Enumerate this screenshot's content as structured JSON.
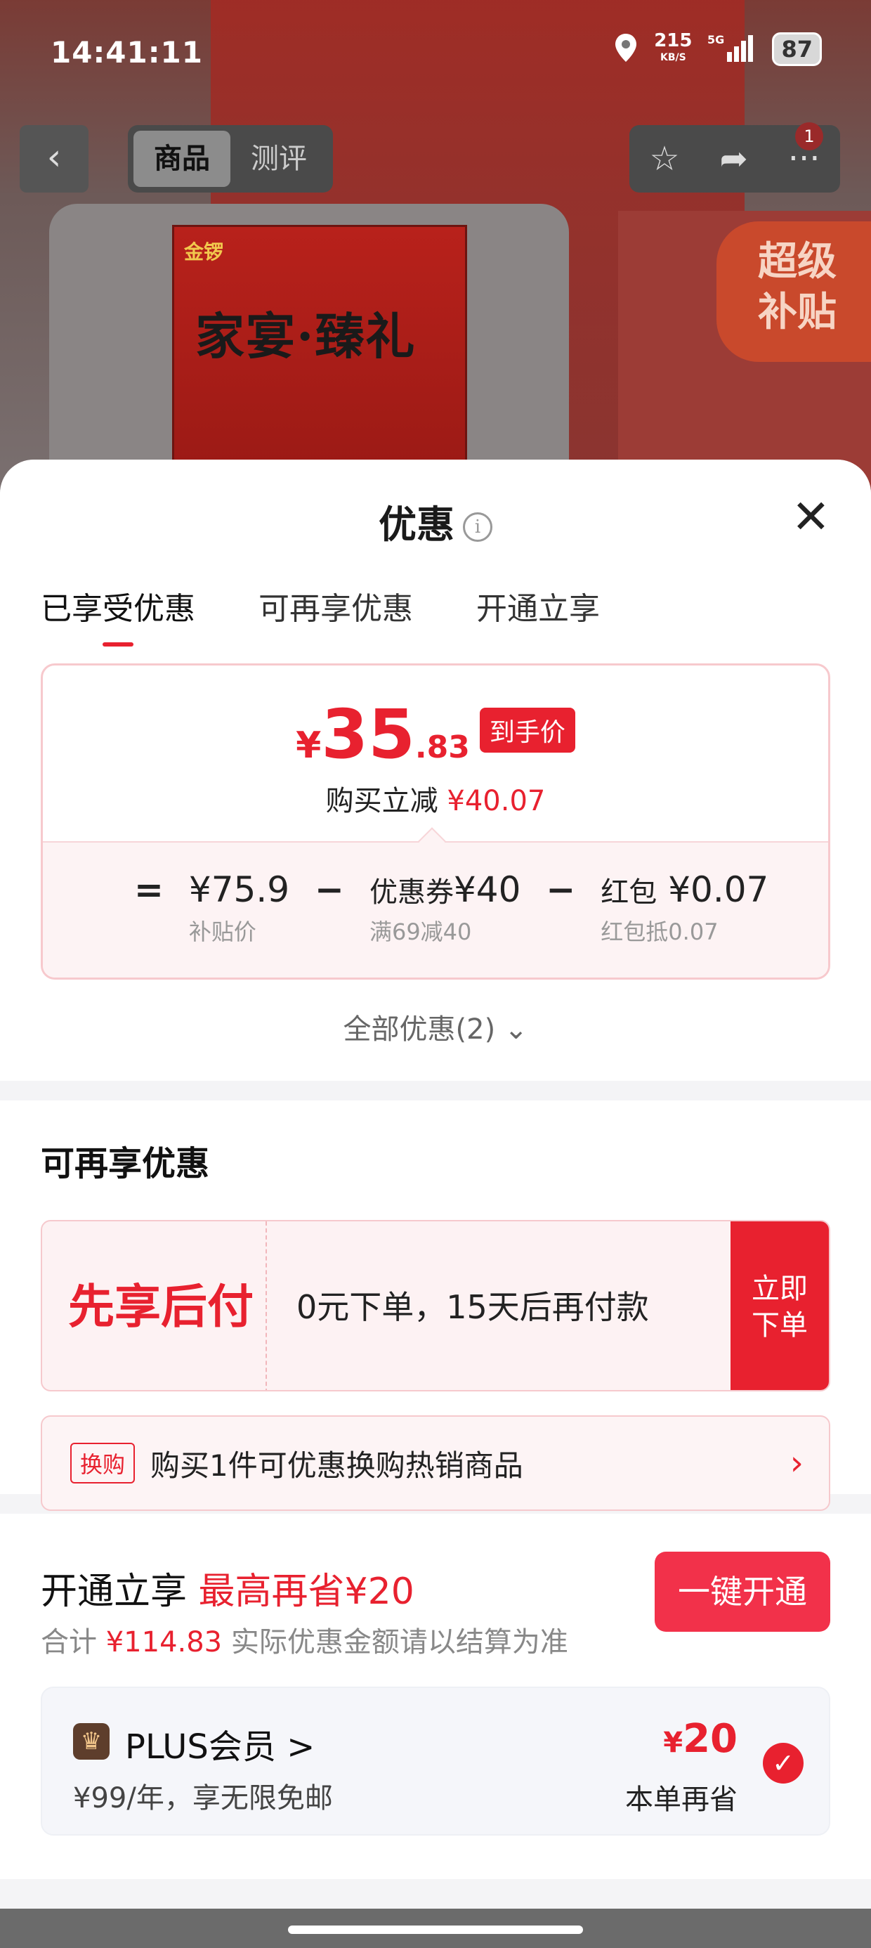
{
  "status": {
    "time": "14:41:11",
    "speed": "215",
    "speed_unit": "KB/S",
    "network": "5G",
    "battery": "87"
  },
  "nav": {
    "tab_goods": "商品",
    "tab_review": "测评",
    "badge_count": "1"
  },
  "background": {
    "brand": "金锣",
    "box_title": "家宴·臻礼",
    "badge_line1": "超级",
    "badge_line2": "补贴"
  },
  "sheet": {
    "title": "优惠",
    "tabs": [
      "已享受优惠",
      "可再享优惠",
      "开通立享"
    ],
    "price": {
      "yen": "¥",
      "int": "35",
      "dec": ".83",
      "tag": "到手价"
    },
    "reduce_label": "购买立减",
    "reduce_value": "¥40.07",
    "formula": {
      "eq": "=",
      "minus": "−",
      "base_value": "¥75.9",
      "base_sub": "补贴价",
      "coupon_label": "优惠券",
      "coupon_value": "¥40",
      "coupon_sub": "满69减40",
      "redpack_label": "红包",
      "redpack_value": "¥0.07",
      "redpack_sub": "红包抵0.07"
    },
    "all_discounts": "全部优惠(2) ⌄"
  },
  "more": {
    "title": "可再享优惠",
    "paylater_name": "先享后付",
    "paylater_desc": "0元下单，15天后再付款",
    "paylater_btn_1": "立即",
    "paylater_btn_2": "下单",
    "swap_tag": "换购",
    "swap_text": "购买1件可优惠换购热销商品"
  },
  "open": {
    "title": "开通立享",
    "highlight": "最高再省¥20",
    "total_label": "合计",
    "total_value": "¥114.83",
    "total_note": "实际优惠金额请以结算为准",
    "button": "一键开通",
    "plus_name": "PLUS会员 >",
    "plus_sub": "¥99/年，享无限免邮",
    "save_yen": "¥",
    "save_value": "20",
    "save_label": "本单再省"
  },
  "colors": {
    "accent": "#e8212f",
    "card_bg": "#fdf3f4"
  }
}
